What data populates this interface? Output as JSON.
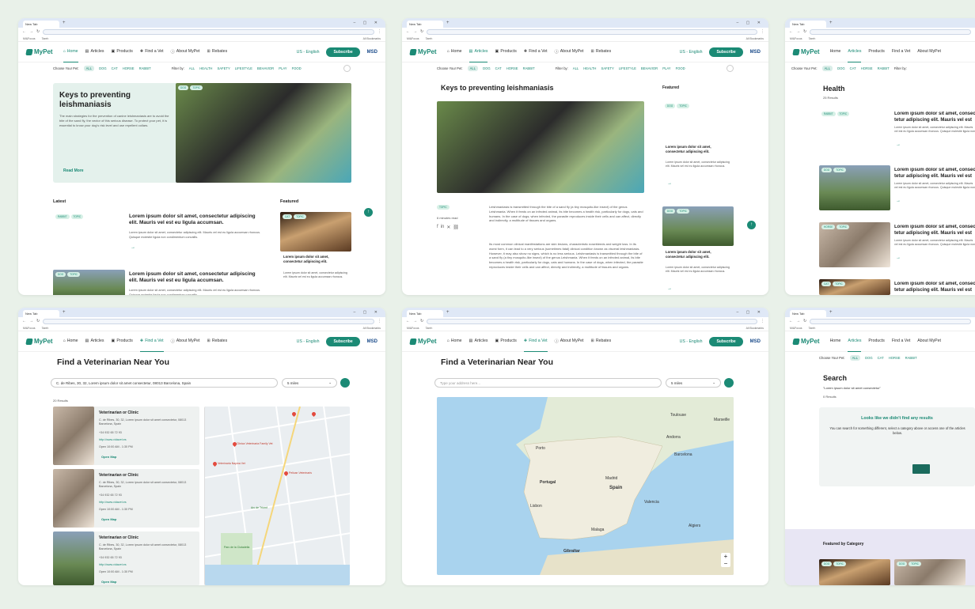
{
  "browser": {
    "tab_title": "New Tab",
    "bookmarks": [
      "Mi&Focus",
      "Tareh"
    ],
    "all_bookmarks": "All Bookmarks"
  },
  "nav": {
    "logo": "MyPet",
    "home": "Home",
    "articles": "Articles",
    "products": "Products",
    "find_vet": "Find a Vet",
    "about": "About MyPet",
    "rebates": "Rebates",
    "lang": "US - English",
    "subscribe": "Subscribe",
    "msd": "MSD",
    "msd_sub": "Animal Health"
  },
  "filter": {
    "choose": "Choose Your Pet:",
    "pets": [
      "ALL",
      "DOG",
      "CAT",
      "HORSE",
      "RABBIT"
    ],
    "filter_by": "Filter by:",
    "cats": [
      "ALL",
      "HEALTH",
      "SAFETY",
      "LIFESTYLE",
      "BEHAVIOR",
      "PLAY",
      "FOOD"
    ]
  },
  "home": {
    "hero_title": "Keys to preventing leishmaniasis",
    "hero_text": "The main strategies for the prevention of canine leishmaniasis are to avoid the bite of the sand fly, the vector of this serious disease. To protect your pet, it is essential to know your dog's risk level and use repellent collars.",
    "read_more": "Read More",
    "hero_tags": [
      "DOG",
      "TOPIC"
    ],
    "latest": "Latest",
    "featured": "Featured",
    "items": [
      {
        "tags": [
          "RABBIT",
          "TOPIC"
        ],
        "title": "Lorem ipsum dolor sit amet, consectetur adipiscing elit. Mauris vel est eu ligula accumsan.",
        "text": "Lorem ipsum dolor sit amet, consectetur adipiscing elit. Mauris vel est eu ligula accumsan rhoncus. Quisque molestie ligula non condimentum convallis."
      },
      {
        "tags": [
          "DOG",
          "TOPIC"
        ],
        "title": "Lorem ipsum dolor sit amet, consectetur adipiscing elit. Mauris vel est eu ligula accumsan.",
        "text": "Lorem ipsum dolor sit amet, consectetur adipiscing elit. Mauris vel est eu ligula accumsan rhoncus. Quisque molestie ligula non condimentum convallis."
      }
    ],
    "feat": {
      "tags": [
        "CAT",
        "TOPIC"
      ],
      "title": "Lorem ipsum dolor sit amet, consectetur adipiscing elit.",
      "text": "Lorem ipsum dolor sit amet, consectetur adipiscing elit. Mauris vel est eu ligula accumsan rhoncus."
    }
  },
  "article": {
    "title": "Keys to preventing leishmaniasis",
    "tag": "TOPIC",
    "read_time": "6 minutes read",
    "p1": "Leishmaniasis is transmitted through the bite of a sand fly (a tiny mosquito-like insect) of the genus Leishmania. When it feeds on an infected animal, its bite becomes a health risk, particularly for dogs, cats and humans. In the case of dogs; when infected, the parasite reproduces inside their cells and can affect, directly and indirectly, a multitude of tissues and organs.",
    "p2": "Its most common clinical manifestations are skin lesions, characteristic nosebleeds and weight loss. In its worst form, it can lead to a very serious (sometimes fatal) clinical condition known as visceral leishmaniasis. However, it may also show no signs, which is no less serious. Leishmaniasis is transmitted through the bite of a sand fly (a tiny mosquito-like insect) of the genus Leishmania. When it feeds on an infected animal, its bite becomes a health risk, particularly for dogs, cats and humans. In the case of dogs, when infected, the parasite reproduces inside their cells and can affect, directly and indirectly, a multitude of tissues and organs.",
    "featured": "Featured",
    "f1": {
      "tags": [
        "DOG",
        "TOPIC"
      ],
      "title": "Lorem ipsum dolor sit amet, consectetur adipiscing elit.",
      "text": "Lorem ipsum dolor sit amet, consectetur adipiscing elit. Mauris vel est eu ligula accumsan rhoncus."
    },
    "f2": {
      "tags": [
        "DOG",
        "TOPIC"
      ],
      "title": "Lorem ipsum dolor sit amet, consectetur adipiscing elit.",
      "text": "Lorem ipsum dolor sit amet, consectetur adipiscing elit. Mauris vel est eu ligula accumsan rhoncus."
    }
  },
  "health": {
    "title": "Health",
    "results": "25 Results",
    "items": [
      {
        "tags": [
          "RABBIT",
          "TOPIC"
        ],
        "title": "Lorem ipsum dolor sit amet, consec tetur adipiscing elit. Mauris vel est eu ligula a",
        "text": "Lorem ipsum dolor sit amet, consectetur adipiscing elit. Mauris vel est eu ligula accumsan rhoncus. Quisque molestie ligula non co"
      },
      {
        "tags": [
          "DOG",
          "TOPIC"
        ],
        "title": "Lorem ipsum dolor sit amet, consec tetur adipiscing elit. Mauris vel est eu ligula a",
        "text": "Lorem ipsum dolor sit amet, consectetur adipiscing elit. Mauris vel est eu ligula accumsan rhoncus. Quisque molestie ligula non co"
      },
      {
        "tags": [
          "HORSE",
          "TOPIC"
        ],
        "title": "Lorem ipsum dolor sit amet, consec tetur adipiscing elit. Mauris vel est eu ligula a",
        "text": "Lorem ipsum dolor sit amet, consectetur adipiscing elit. Mauris vel est eu ligula accumsan rhoncus. Quisque molestie ligula non co"
      },
      {
        "tags": [
          "CAT",
          "TOPIC"
        ],
        "title": "Lorem ipsum dolor sit amet, consec tetur adipiscing elit. Mauris vel est eu ligula a",
        "text": ""
      }
    ]
  },
  "findvet": {
    "title": "Find a Veterinarian Near You",
    "address": "C. de Ribes, 30, 32, Lorem ipsum dolor sit amet consectetur, 08013 Barcelona, Spain",
    "miles": "5 miles",
    "results": "20 Results",
    "placeholder": "Type your address here...",
    "clinics": [
      {
        "name": "Veterinarian or Clinic",
        "addr": "C. de Ribes, 30, 32, Lorem ipsum dolor sit amet consectetur, 08013 Barcelona, Spain",
        "phone": "+34 932 65 72 93",
        "web": "http://www.vidavet.es",
        "hours": "Open 10:00 AM - 1:30 PM",
        "map": "Open Map"
      },
      {
        "name": "Veterinarian or Clinic",
        "addr": "C. de Ribes, 30, 32, Lorem ipsum dolor sit amet consectetur, 08013 Barcelona, Spain",
        "phone": "+34 932 65 72 93",
        "web": "http://www.vidavet.es",
        "hours": "Open 10:00 AM - 1:30 PM",
        "map": "Open Map"
      },
      {
        "name": "Veterinarian or Clinic",
        "addr": "C. de Ribes, 30, 32, Lorem ipsum dolor sit amet consectetur, 08013 Barcelona, Spain",
        "phone": "+34 932 65 72 93",
        "web": "http://www.vidavet.es",
        "hours": "Open 10:00 AM - 1:30 PM",
        "map": "Open Map"
      }
    ],
    "map_labels": [
      "Clinica Veterinaria Family Vet",
      "Veterinaria Nayma Vet",
      "Pelican Veterinaris",
      "Arc de Triomf",
      "Parc de la Ciutadella",
      "Valencia",
      "Andorra",
      "Toulouse",
      "Marseille",
      "Portugal",
      "Spain",
      "Madrid",
      "Lisbon",
      "Barcelona",
      "Valencia",
      "Algiers",
      "Gibraltar",
      "Malaga",
      "Porto"
    ]
  },
  "search": {
    "title": "Search",
    "query": "\"Lorem ipsum dolor sit amet consectetur\"",
    "results": "0 Results",
    "empty_title": "Looks like we didn't find any results",
    "empty_text": "You can search for something different, select a category above or access one of the articles below.",
    "featured_by_cat": "Featured by Category"
  }
}
